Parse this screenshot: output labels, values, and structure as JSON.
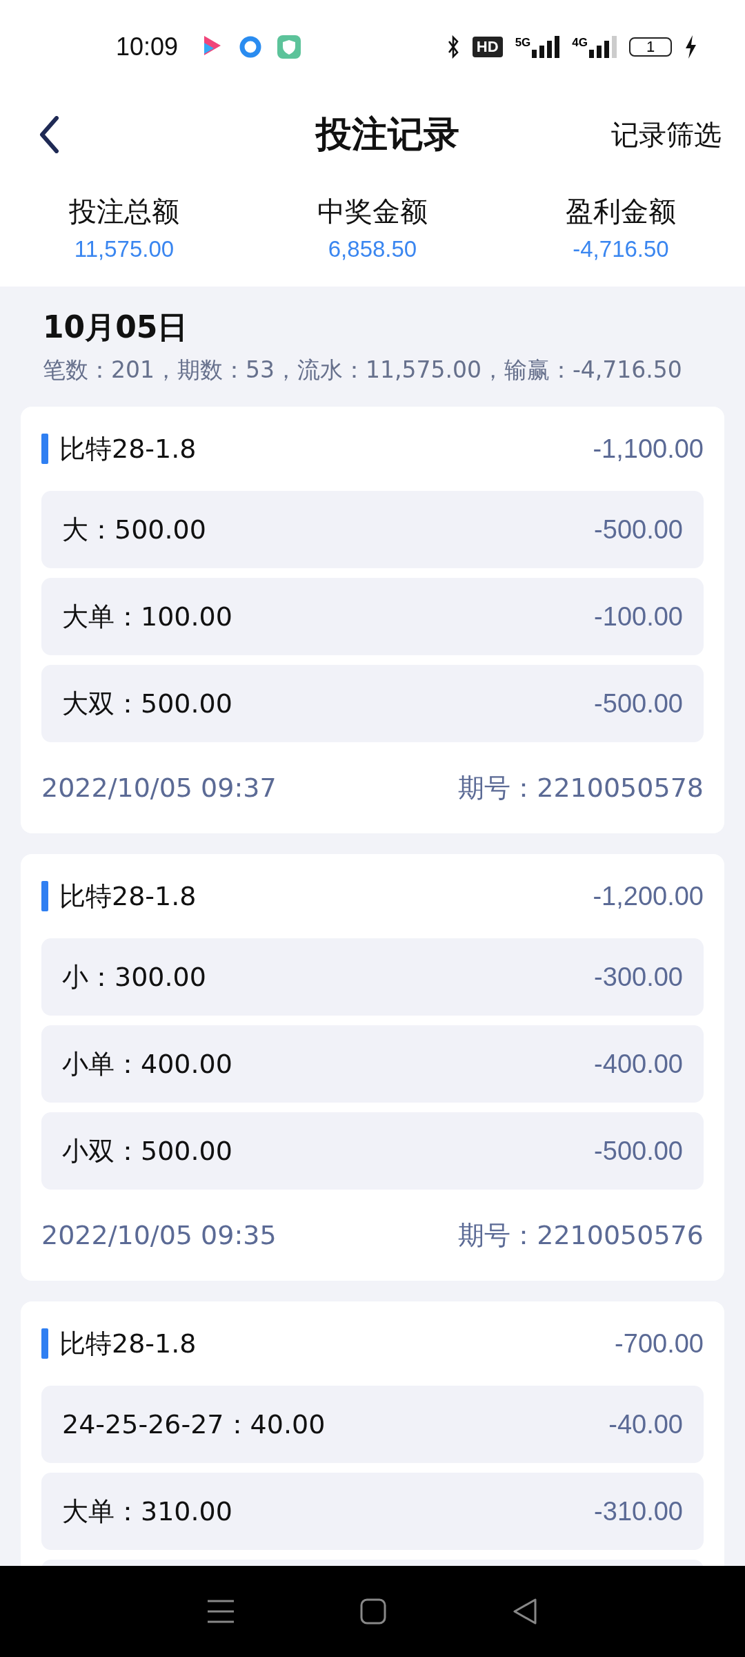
{
  "status_bar": {
    "time": "10:09",
    "network_5g": "5G",
    "network_4g": "4G",
    "hd": "HD",
    "battery": "1"
  },
  "header": {
    "title": "投注记录",
    "action": "记录筛选"
  },
  "summary": [
    {
      "label": "投注总额",
      "value": "11,575.00"
    },
    {
      "label": "中奖金额",
      "value": "6,858.50"
    },
    {
      "label": "盈利金额",
      "value": "-4,716.50"
    }
  ],
  "day": {
    "date": "10月05日",
    "stats": "笔数：201，期数：53，流水：11,575.00，输赢：-4,716.50"
  },
  "records": [
    {
      "game": "比特28-1.8",
      "total": "-1,100.00",
      "bets": [
        {
          "label": "大：500.00",
          "result": "-500.00"
        },
        {
          "label": "大单：100.00",
          "result": "-100.00"
        },
        {
          "label": "大双：500.00",
          "result": "-500.00"
        }
      ],
      "time": "2022/10/05 09:37",
      "issue": "期号：2210050578",
      "cut_off": false
    },
    {
      "game": "比特28-1.8",
      "total": "-1,200.00",
      "bets": [
        {
          "label": "小：300.00",
          "result": "-300.00"
        },
        {
          "label": "小单：400.00",
          "result": "-400.00"
        },
        {
          "label": "小双：500.00",
          "result": "-500.00"
        }
      ],
      "time": "2022/10/05 09:35",
      "issue": "期号：2210050576",
      "cut_off": false
    },
    {
      "game": "比特28-1.8",
      "total": "-700.00",
      "bets": [
        {
          "label": "24-25-26-27：40.00",
          "result": "-40.00"
        },
        {
          "label": "大单：310.00",
          "result": "-310.00"
        }
      ],
      "cut_off": true
    }
  ]
}
